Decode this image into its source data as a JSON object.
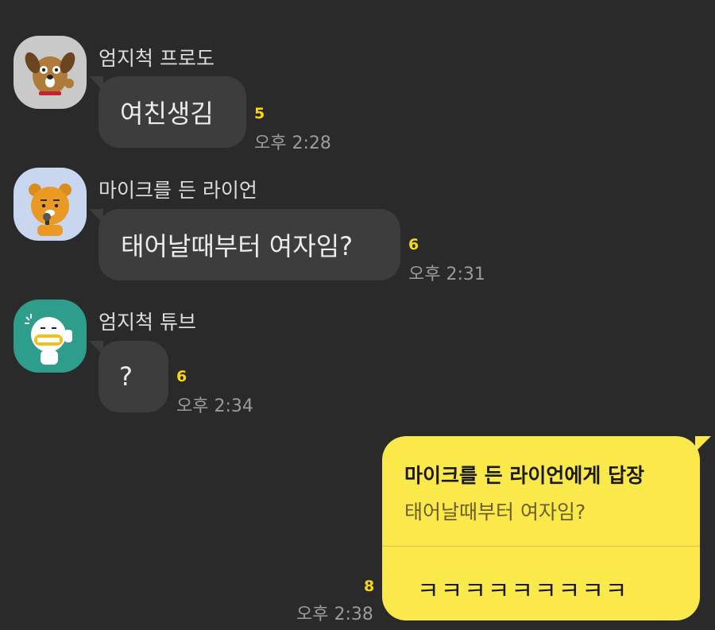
{
  "messages": [
    {
      "sender": "엄지척 프로도",
      "text": "여친생김",
      "unread": "5",
      "time": "오후 2:28",
      "avatar_icon": "frodo-dog-avatar-icon"
    },
    {
      "sender": "마이크를 든 라이언",
      "text": "태어날때부터 여자임?",
      "unread": "6",
      "time": "오후 2:31",
      "avatar_icon": "ryan-lion-avatar-icon"
    },
    {
      "sender": "엄지척 튜브",
      "text": "?",
      "unread": "6",
      "time": "오후 2:34",
      "avatar_icon": "tube-duck-avatar-icon"
    }
  ],
  "my_reply": {
    "reply_to_title": "마이크를 든 라이언에게 답장",
    "quoted_text": "태어날때부터 여자임?",
    "text": "ㅋㅋㅋㅋㅋㅋㅋㅋㅋ",
    "unread": "8",
    "time": "오후 2:38"
  },
  "colors": {
    "background": "#2a2a2a",
    "bubble_other": "#3d3d3d",
    "bubble_mine": "#fbe84a",
    "unread_count": "#f7d716"
  }
}
